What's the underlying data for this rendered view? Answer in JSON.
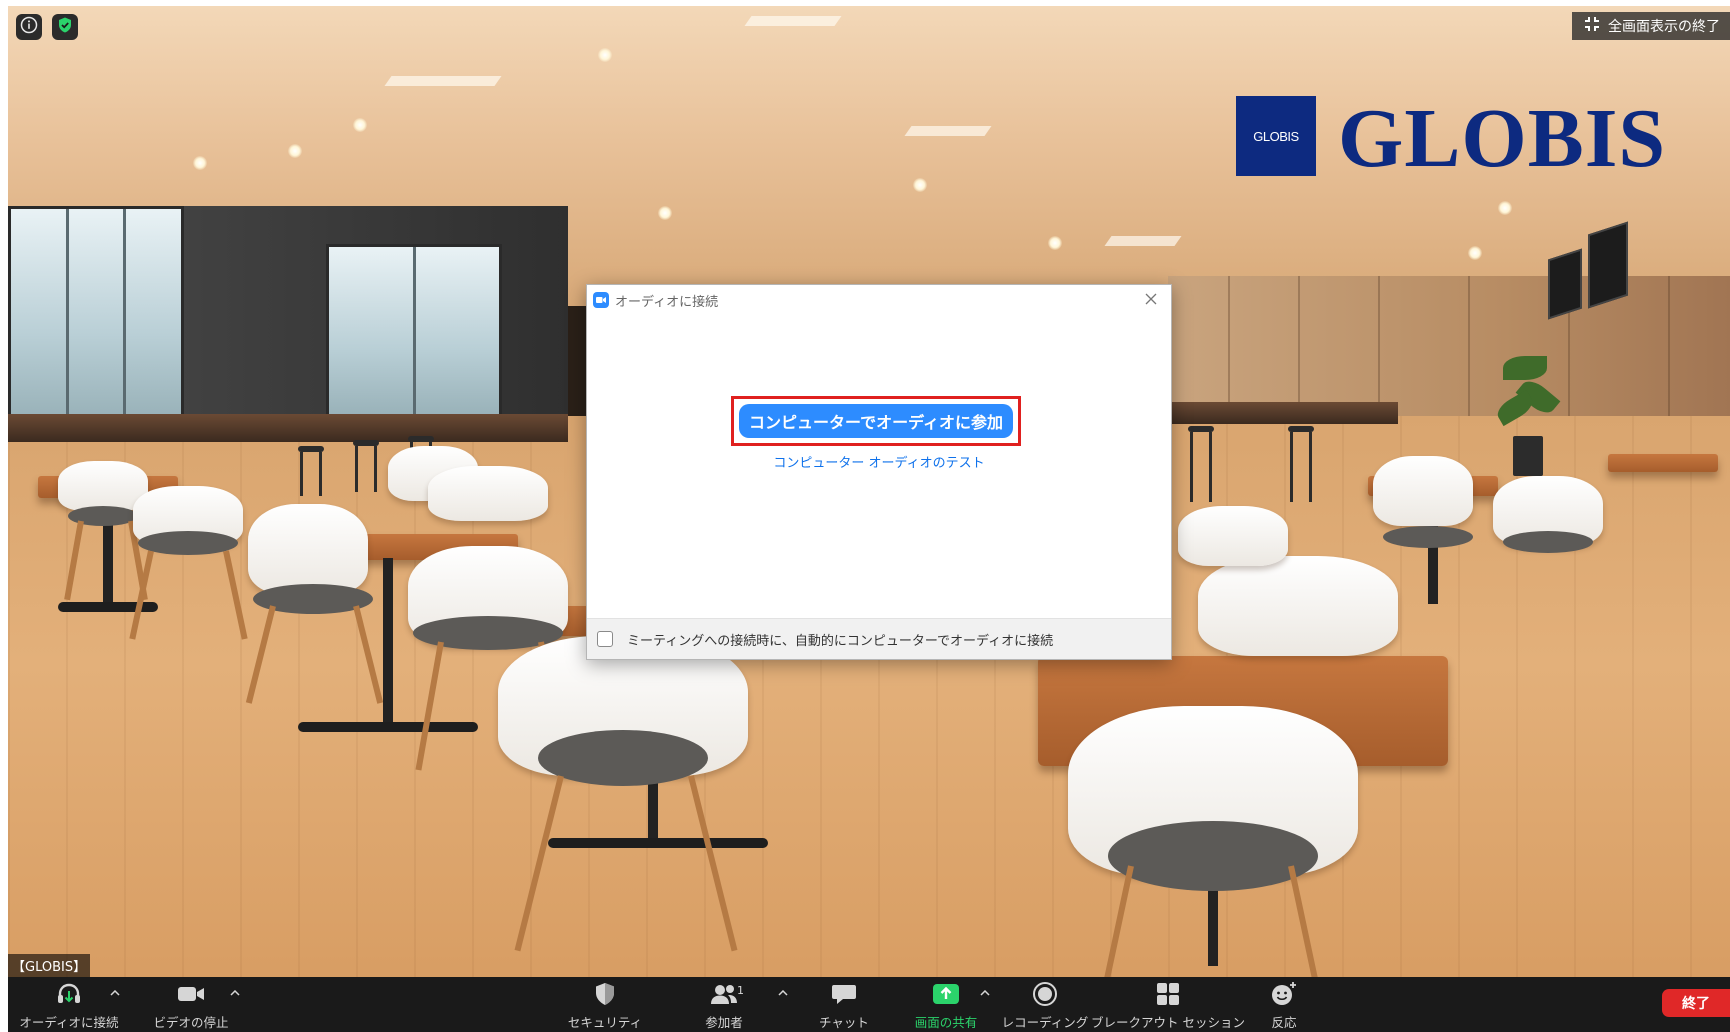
{
  "window": {
    "exit_fullscreen_label": "全画面表示の終了"
  },
  "background": {
    "logo_box_text": "GLOBIS",
    "logo_word": "GLOBIS",
    "brand_color": "#0d2a80"
  },
  "participant": {
    "name_tag": "【GLOBIS】"
  },
  "dialog": {
    "title": "オーディオに接続",
    "join_button_label": "コンピューターでオーディオに参加",
    "test_link_label": "コンピューター オーディオのテスト",
    "auto_join_checkbox_label": "ミーティングへの接続時に、自動的にコンピューターでオーディオに接続",
    "auto_join_checked": false,
    "accent_color": "#2d8cff",
    "highlight_color": "#e0201f"
  },
  "toolbar": {
    "audio_label": "オーディオに接続",
    "video_label": "ビデオの停止",
    "security_label": "セキュリティ",
    "participants_label": "参加者",
    "participants_count": "1",
    "chat_label": "チャット",
    "share_label": "画面の共有",
    "record_label": "レコーディング",
    "breakout_label": "ブレークアウト セッション",
    "reactions_label": "反応",
    "end_label": "終了",
    "share_color": "#2bd36b",
    "end_color": "#e02828"
  },
  "icons": {
    "info": "info-icon",
    "security_status": "shield-check-icon",
    "exit_fullscreen": "exit-fullscreen-icon",
    "audio": "headphones-icon",
    "video": "video-camera-icon",
    "security": "shield-icon",
    "participants": "people-icon",
    "chat": "chat-bubble-icon",
    "share": "share-screen-icon",
    "record": "record-icon",
    "breakout": "grid-icon",
    "reactions": "smiley-plus-icon",
    "close": "close-icon",
    "caret": "chevron-up-icon"
  }
}
